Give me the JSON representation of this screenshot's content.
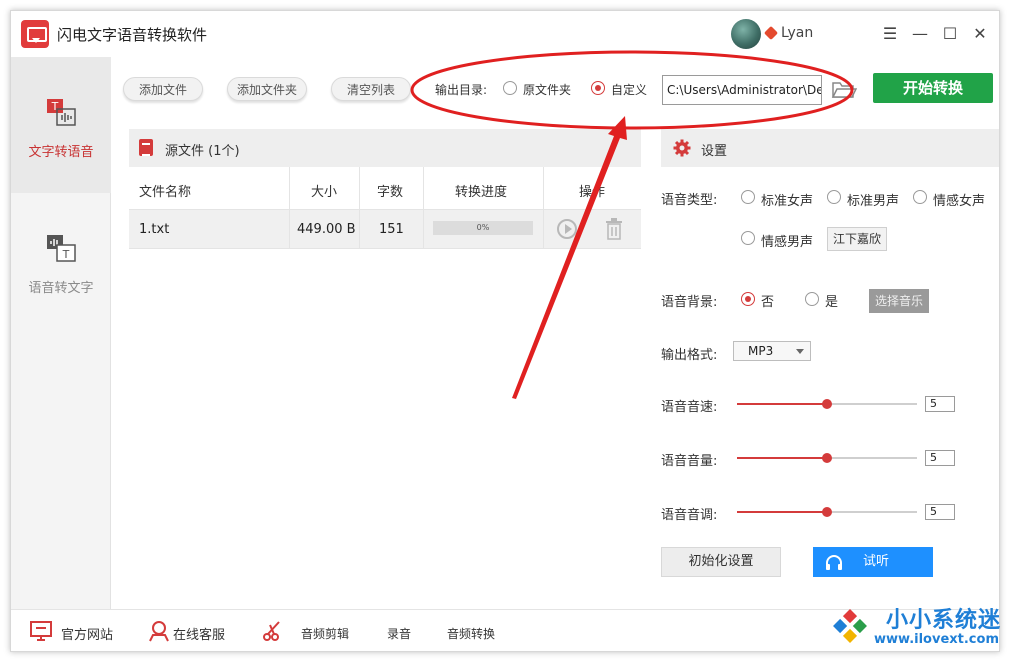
{
  "app": {
    "title": "闪电文字语音转换软件",
    "username": "Lyan"
  },
  "sidebar": {
    "items": [
      {
        "label": "文字转语音",
        "active": true
      },
      {
        "label": "语音转文字",
        "active": false
      }
    ]
  },
  "toolbar": {
    "add_file": "添加文件",
    "add_folder": "添加文件夹",
    "clear_list": "清空列表",
    "output_label": "输出目录:",
    "opt_source": "原文件夹",
    "opt_custom": "自定义",
    "selected": "自定义",
    "path_value": "C:\\Users\\Administrator\\De",
    "start": "开始转换"
  },
  "files": {
    "title": "源文件 (1个)",
    "columns": [
      "文件名称",
      "大小",
      "字数",
      "转换进度",
      "操作"
    ],
    "rows": [
      {
        "name": "1.txt",
        "size": "449.00 B",
        "words": "151",
        "progress": 0,
        "progress_text": "0%"
      }
    ]
  },
  "settings": {
    "title": "设置",
    "voice_type_label": "语音类型:",
    "voice_options": [
      "标准女声",
      "标准男声",
      "情感女声",
      "情感男声"
    ],
    "voice_name": "江下嘉欣",
    "bg_label": "语音背景:",
    "bg_options": [
      "否",
      "是"
    ],
    "bg_selected": "否",
    "music_button": "选择音乐",
    "format_label": "输出格式:",
    "format_value": "MP3",
    "speed_label": "语音音速:",
    "speed_value": "5",
    "volume_label": "语音音量:",
    "volume_value": "5",
    "pitch_label": "语音音调:",
    "pitch_value": "5",
    "slider_max": 10,
    "init_button": "初始化设置",
    "listen_button": "试听"
  },
  "footer": {
    "website": "官方网站",
    "service": "在线客服",
    "audio_cut": "音频剪辑",
    "record": "录音",
    "audio_convert": "音频转换"
  },
  "watermark": {
    "text": "小小系统迷",
    "url": "www.ilovext.com"
  },
  "colors": {
    "accent_red": "#d43b3b",
    "start_green": "#21a348",
    "listen_blue": "#1e90ff"
  }
}
